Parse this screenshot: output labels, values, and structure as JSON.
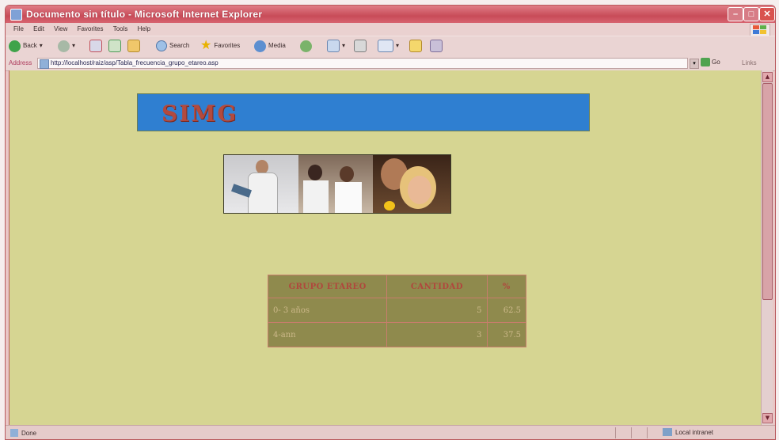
{
  "window": {
    "title": "Documento sin título - Microsoft Internet Explorer",
    "controls": {
      "minimize": "–",
      "maximize": "□",
      "close": "✕"
    }
  },
  "menu": [
    "File",
    "Edit",
    "View",
    "Favorites",
    "Tools",
    "Help"
  ],
  "toolbar": {
    "back_label": "Back",
    "search_label": "Search",
    "favorites_label": "Favorites",
    "media_label": "Media"
  },
  "address": {
    "label": "Address",
    "url": "http://localhost/raiz/asp/Tabla_frecuencia_grupo_etareo.asp",
    "go_label": "Go",
    "links_label": "Links"
  },
  "page": {
    "banner_title": "SIMG",
    "table": {
      "headers": [
        "Grupo Etareo",
        "Cantidad",
        "%"
      ],
      "rows": [
        {
          "grupo": "0- 3 años",
          "cantidad": "5",
          "porcentaje": "62.5"
        },
        {
          "grupo": "4-ann",
          "cantidad": "3",
          "porcentaje": "37.5"
        }
      ]
    }
  },
  "status": {
    "left": "Done",
    "zone": "Local intranet"
  },
  "colors": {
    "page_background": "#d6d592",
    "banner": "#2f7fd1",
    "banner_text": "#b34a3e",
    "table_background": "#8f8a4d",
    "table_border": "#c77d6c"
  }
}
